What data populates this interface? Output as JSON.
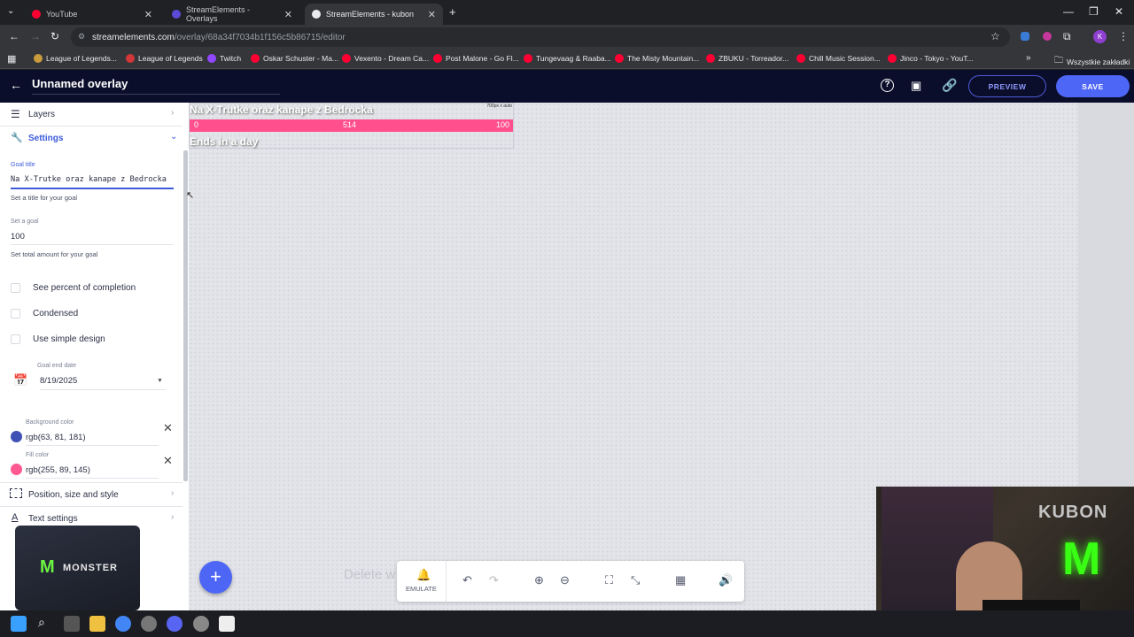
{
  "tabs": [
    {
      "label": "YouTube",
      "color": "#ff0033"
    },
    {
      "label": "StreamElements - Overlays",
      "color": "#5b4bd6"
    },
    {
      "label": "StreamElements - kubon",
      "color": "#ffffff"
    }
  ],
  "url": {
    "host": "streamelements.com",
    "path": "/overlay/68a34f7034b1f156c5b86715/editor"
  },
  "bookmarks": [
    "League of Legends...",
    "League of Legends",
    "Twitch",
    "Oskar Schuster - Ma...",
    "Vexento - Dream Ca...",
    "Post Malone - Go Fl...",
    "Tungevaag & Raaba...",
    "The Misty Mountain...",
    "ZBUKU - Torreador...",
    "Chill Music Session...",
    "Jinco - Tokyo - YouT..."
  ],
  "all_bookmarks": "Wszystkie zakładki",
  "header": {
    "title": "Unnamed overlay",
    "preview": "PREVIEW",
    "save": "SAVE"
  },
  "sidebar": {
    "layers": "Layers",
    "settings": "Settings",
    "goal_title": {
      "label": "Goal title",
      "value": "Na X-Trutke oraz kanape z Bedrocka",
      "help": "Set a title for your goal"
    },
    "goal": {
      "label": "Set a goal",
      "value": "100",
      "help": "Set total amount for your goal"
    },
    "checks": [
      "See percent of completion",
      "Condensed",
      "Use simple design"
    ],
    "end_date": {
      "label": "Goal end date",
      "value": "8/19/2025"
    },
    "bg_color": {
      "label": "Background color",
      "value": "rgb(63, 81, 181)",
      "swatch": "#3f51b5"
    },
    "fill_color": {
      "label": "Fill color",
      "value": "rgb(255, 89, 145)",
      "swatch": "#ff5991"
    },
    "position": "Position, size and style",
    "text_settings": "Text settings",
    "monster": "MONSTER"
  },
  "widget": {
    "title": "Na X-Trutke oraz kanape z Bedrocka",
    "size_tag": "700px x auto",
    "start": "0",
    "current": "514",
    "end": "100",
    "ends": "Ends in a day",
    "fill": "#ff4f8d"
  },
  "toolbar": {
    "emulate": "EMULATE",
    "delete_hint": "Delete w"
  },
  "cam_logo": "KUBON"
}
